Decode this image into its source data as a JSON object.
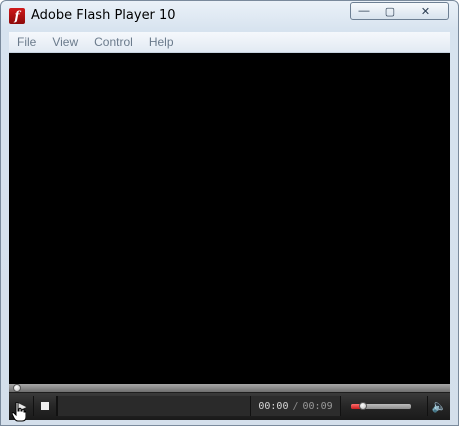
{
  "window": {
    "title": "Adobe Flash Player 10",
    "app_icon_glyph": "f",
    "app_icon_name": "flash-player-icon",
    "buttons": {
      "minimize_glyph": "—",
      "maximize_glyph": "▢",
      "close_glyph": "✕"
    }
  },
  "menubar": {
    "items": [
      {
        "label": "File"
      },
      {
        "label": "View"
      },
      {
        "label": "Control"
      },
      {
        "label": "Help"
      }
    ]
  },
  "player": {
    "play_glyph": "▶",
    "seek_progress": 0.0,
    "time": {
      "current": "00:00",
      "separator": "/",
      "total": "00:09"
    },
    "volume_level": 0.2,
    "speaker_glyph": "🔈"
  },
  "colors": {
    "stage": "#000000",
    "volume_fill": "#d42a2a",
    "flash_icon": "#c41414"
  }
}
